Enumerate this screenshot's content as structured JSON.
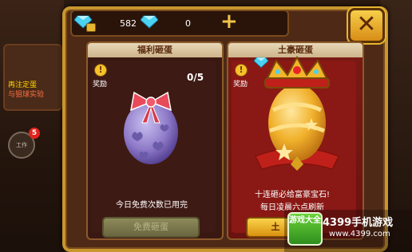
{
  "background": {
    "side_text1": "再注定蛋",
    "side_text2": "与狙球实验",
    "side_icon_label": "工作",
    "side_badge": "5"
  },
  "currency": {
    "locked_gems": "582",
    "gems": "0",
    "add_label": "+"
  },
  "close_label": "✕",
  "cards": {
    "welfare": {
      "title": "福利砸蛋",
      "reward_label": "奖励",
      "counter": "0/5",
      "info": "今日免费次数已用完",
      "button": "免费砸蛋"
    },
    "tuhao": {
      "title": "土豪砸蛋",
      "reward_label": "奖励",
      "info1": "十连砸必给富豪宝石!",
      "info2": "每日凌晨六点刷新",
      "button": "土"
    }
  },
  "watermark": {
    "logo": "游戏大全",
    "brand": "4399手机游戏",
    "url": "www.4399.com"
  },
  "colors": {
    "frame_gold": "#c8962e",
    "panel_brown": "#4e2a16",
    "tuhao_red": "#8a1814",
    "egg_purple": "#8e7ac9",
    "egg_gold": "#f0b02a"
  }
}
